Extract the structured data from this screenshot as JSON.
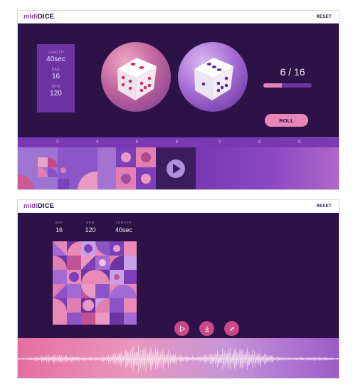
{
  "app": {
    "logo_prefix": "midi",
    "logo_suffix": "DICE",
    "reset_label": "RESET"
  },
  "roll_screen": {
    "info": {
      "length_label": "LENGTH",
      "length_value": "40sec",
      "bar_label": "BAR",
      "bar_value": "16",
      "bpm_label": "BPM",
      "bpm_value": "120"
    },
    "counter": "6 / 16",
    "progress": 0.375,
    "roll_label": "ROLL",
    "bar_numbers": [
      "3",
      "4",
      "5",
      "6",
      "7",
      "8",
      "9"
    ]
  },
  "result_screen": {
    "stats": [
      {
        "label": "BAR",
        "value": "16"
      },
      {
        "label": "BPM",
        "value": "120"
      },
      {
        "label": "LENGTH",
        "value": "40sec"
      }
    ],
    "actions": [
      "play-icon",
      "download-icon",
      "link-icon"
    ]
  },
  "colors": {
    "bg": "#2c1246",
    "accent": "#e886b8",
    "purple": "#7a37b4"
  }
}
